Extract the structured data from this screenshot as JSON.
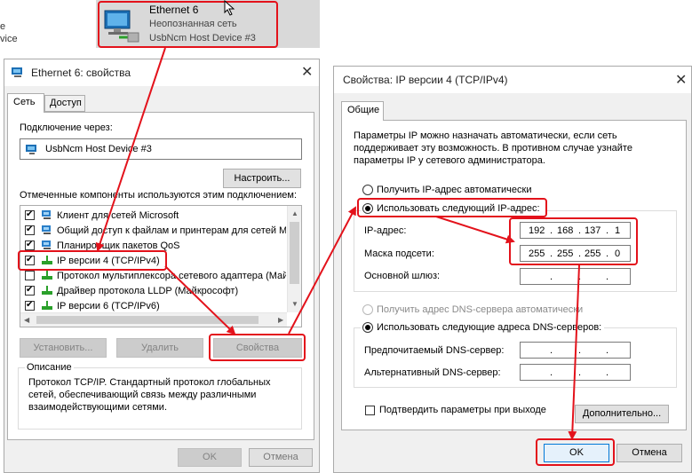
{
  "network_tile": {
    "left_text_1": "e",
    "left_text_2": "vice",
    "name": "Ethernet 6",
    "status": "Неопознанная сеть",
    "device": "UsbNcm Host Device #3"
  },
  "left_dialog": {
    "title": "Ethernet 6: свойства",
    "tabs": [
      "Сеть",
      "Доступ"
    ],
    "connect_using_label": "Подключение через:",
    "adapter_name": "UsbNcm Host Device #3",
    "configure_button": "Настроить...",
    "components_label": "Отмеченные компоненты используются этим подключением:",
    "components": [
      {
        "label": "Клиент для сетей Microsoft",
        "checked": true,
        "icon": "network-client-icon"
      },
      {
        "label": "Общий доступ к файлам и принтерам для сетей Mi",
        "checked": true,
        "icon": "file-share-icon"
      },
      {
        "label": "Планировщик пакетов QoS",
        "checked": true,
        "icon": "qos-icon"
      },
      {
        "label": "IP версии 4 (TCP/IPv4)",
        "checked": true,
        "icon": "protocol-icon"
      },
      {
        "label": "Протокол мультиплексора сетевого адаптера (Май",
        "checked": false,
        "icon": "protocol-icon"
      },
      {
        "label": "Драйвер протокола LLDP (Майкрософт)",
        "checked": true,
        "icon": "protocol-icon"
      },
      {
        "label": "IP версии 6 (TCP/IPv6)",
        "checked": true,
        "icon": "protocol-icon"
      }
    ],
    "install_button": "Установить...",
    "uninstall_button": "Удалить",
    "properties_button": "Свойства",
    "description_title": "Описание",
    "description_text": "Протокол TCP/IP. Стандартный протокол глобальных сетей, обеспечивающий связь между различными взаимодействующими сетями.",
    "ok_button": "OK",
    "cancel_button": "Отмена"
  },
  "right_dialog": {
    "title": "Свойства: IP версии 4 (TCP/IPv4)",
    "tab": "Общие",
    "info_text": "Параметры IP можно назначать автоматически, если сеть поддерживает эту возможность. В противном случае узнайте параметры IP у сетевого администратора.",
    "auto_ip_radio": "Получить IP-адрес автоматически",
    "manual_ip_radio": "Использовать следующий IP-адрес:",
    "ip_label": "IP-адрес:",
    "ip_octets": [
      "192",
      "168",
      "137",
      "1"
    ],
    "mask_label": "Маска подсети:",
    "mask_octets": [
      "255",
      "255",
      "255",
      "0"
    ],
    "gateway_label": "Основной шлюз:",
    "auto_dns_radio": "Получить адрес DNS-сервера автоматически",
    "manual_dns_radio": "Использовать следующие адреса DNS-серверов:",
    "preferred_dns_label": "Предпочитаемый DNS-сервер:",
    "alternate_dns_label": "Альтернативный DNS-сервер:",
    "validate_checkbox": "Подтвердить параметры при выходе",
    "advanced_button": "Дополнительно...",
    "ok_button": "OK",
    "cancel_button": "Отмена"
  },
  "colors": {
    "annotation_red": "#e3121b",
    "window_bg": "#f0f0f0",
    "tile_bg": "#d9d9d9"
  }
}
